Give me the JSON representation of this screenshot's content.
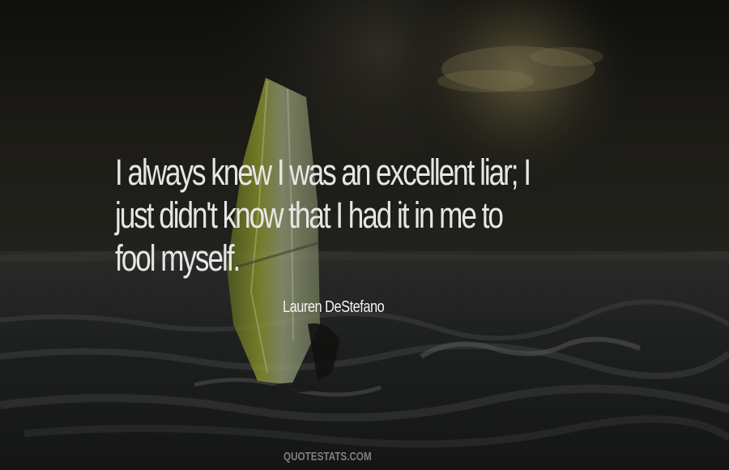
{
  "quote": {
    "lines": [
      "I always knew I was an excellent liar; I",
      "just didn't know that I had it in me to",
      "fool myself."
    ]
  },
  "author": "Lauren DeStefano",
  "watermark": "QUOTESTATS.COM",
  "colors": {
    "quote_text": "#e6e6e6",
    "author_text": "#f2f2f2",
    "watermark_text": "#8a8a86",
    "sky_dark": "#161511",
    "sea_dark": "#1b1d1d",
    "sail_yellow": "#8f9a2c"
  }
}
